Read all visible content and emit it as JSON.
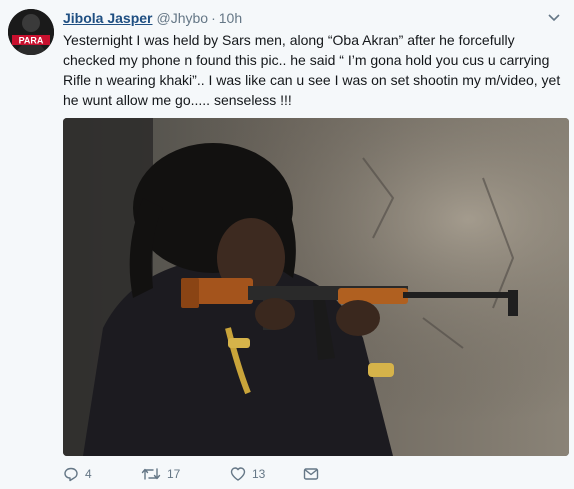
{
  "tweet": {
    "author_name": "Jibola Jasper",
    "handle": "@Jhybo",
    "separator": "·",
    "time": "10h",
    "text": "Yesternight I was held by Sars men, along “Oba Akran” after he forcefully checked my phone n found this pic.. he said “ I’m gona hold you cus u carrying Rifle  n wearing khaki”.. I was like can u see I was on set shootin my m/video, yet he wunt allow me go..... senseless !!!",
    "avatar_text": "PARA"
  },
  "actions": {
    "reply_count": "4",
    "retweet_count": "17",
    "like_count": "13"
  },
  "icons": {
    "caret": "chevron-down-icon",
    "reply": "reply-icon",
    "retweet": "retweet-icon",
    "like": "heart-icon",
    "dm": "envelope-icon"
  },
  "colors": {
    "name": "#1f4f82",
    "secondary": "#657786",
    "background": "#f5f8fa"
  }
}
